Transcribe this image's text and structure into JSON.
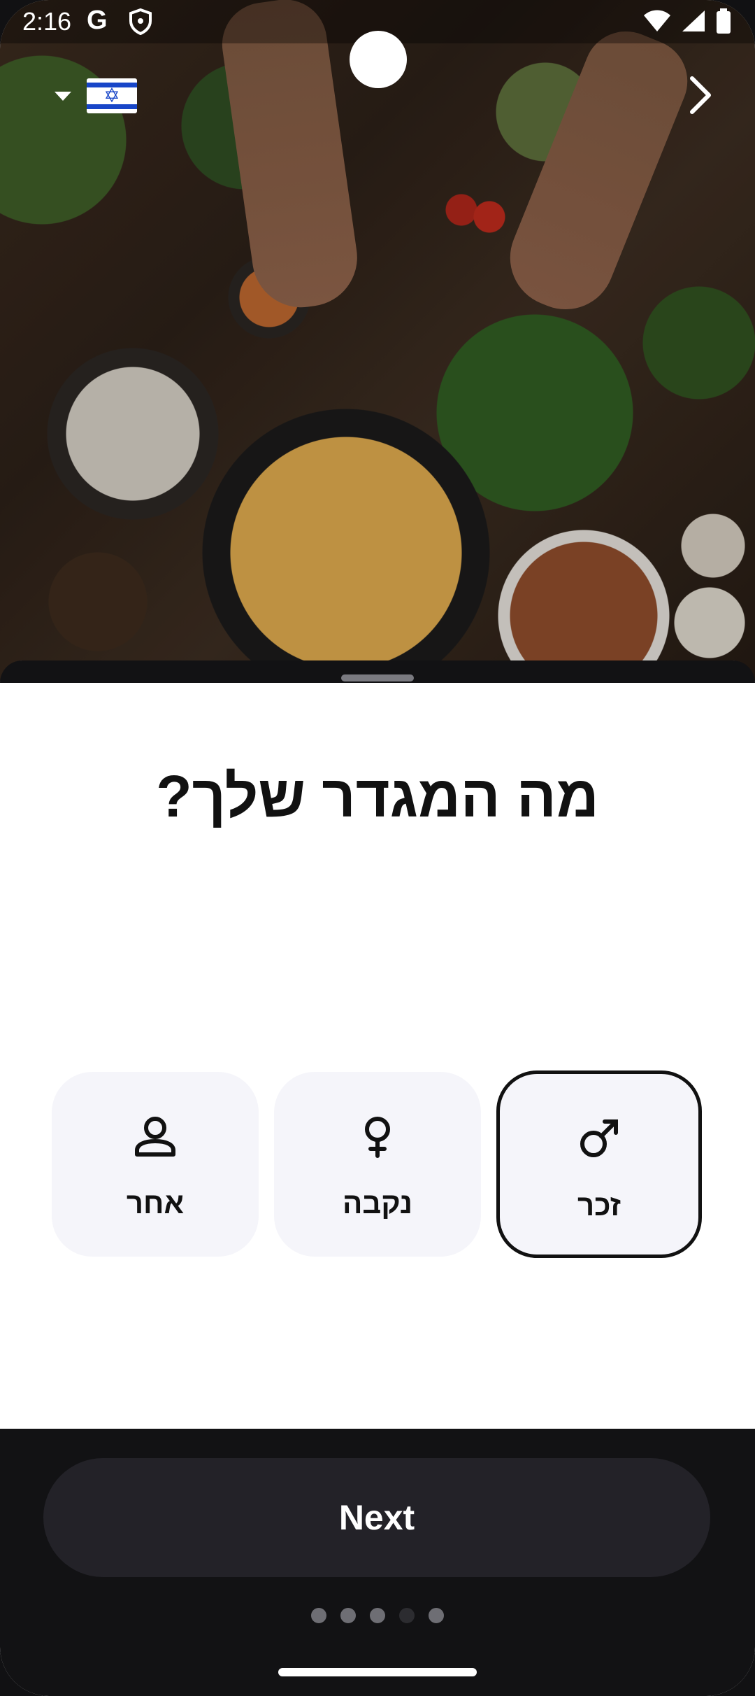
{
  "status_bar": {
    "time": "2:16",
    "g_label": "G"
  },
  "hero": {
    "language_flag": "Israel flag",
    "star_glyph": "✡"
  },
  "question": "מה המגדר שלך?",
  "options": [
    {
      "label": "זכר",
      "icon": "male-icon",
      "selected": true
    },
    {
      "label": "נקבה",
      "icon": "female-icon",
      "selected": false
    },
    {
      "label": "אחר",
      "icon": "person-icon",
      "selected": false
    }
  ],
  "next_button": {
    "label": "Next"
  },
  "pagination": {
    "total": 5,
    "current": 4
  },
  "colors": {
    "selected_border": "#111111",
    "option_bg": "#f5f5fa",
    "bottom_bg": "#121214",
    "button_bg": "#232228"
  }
}
